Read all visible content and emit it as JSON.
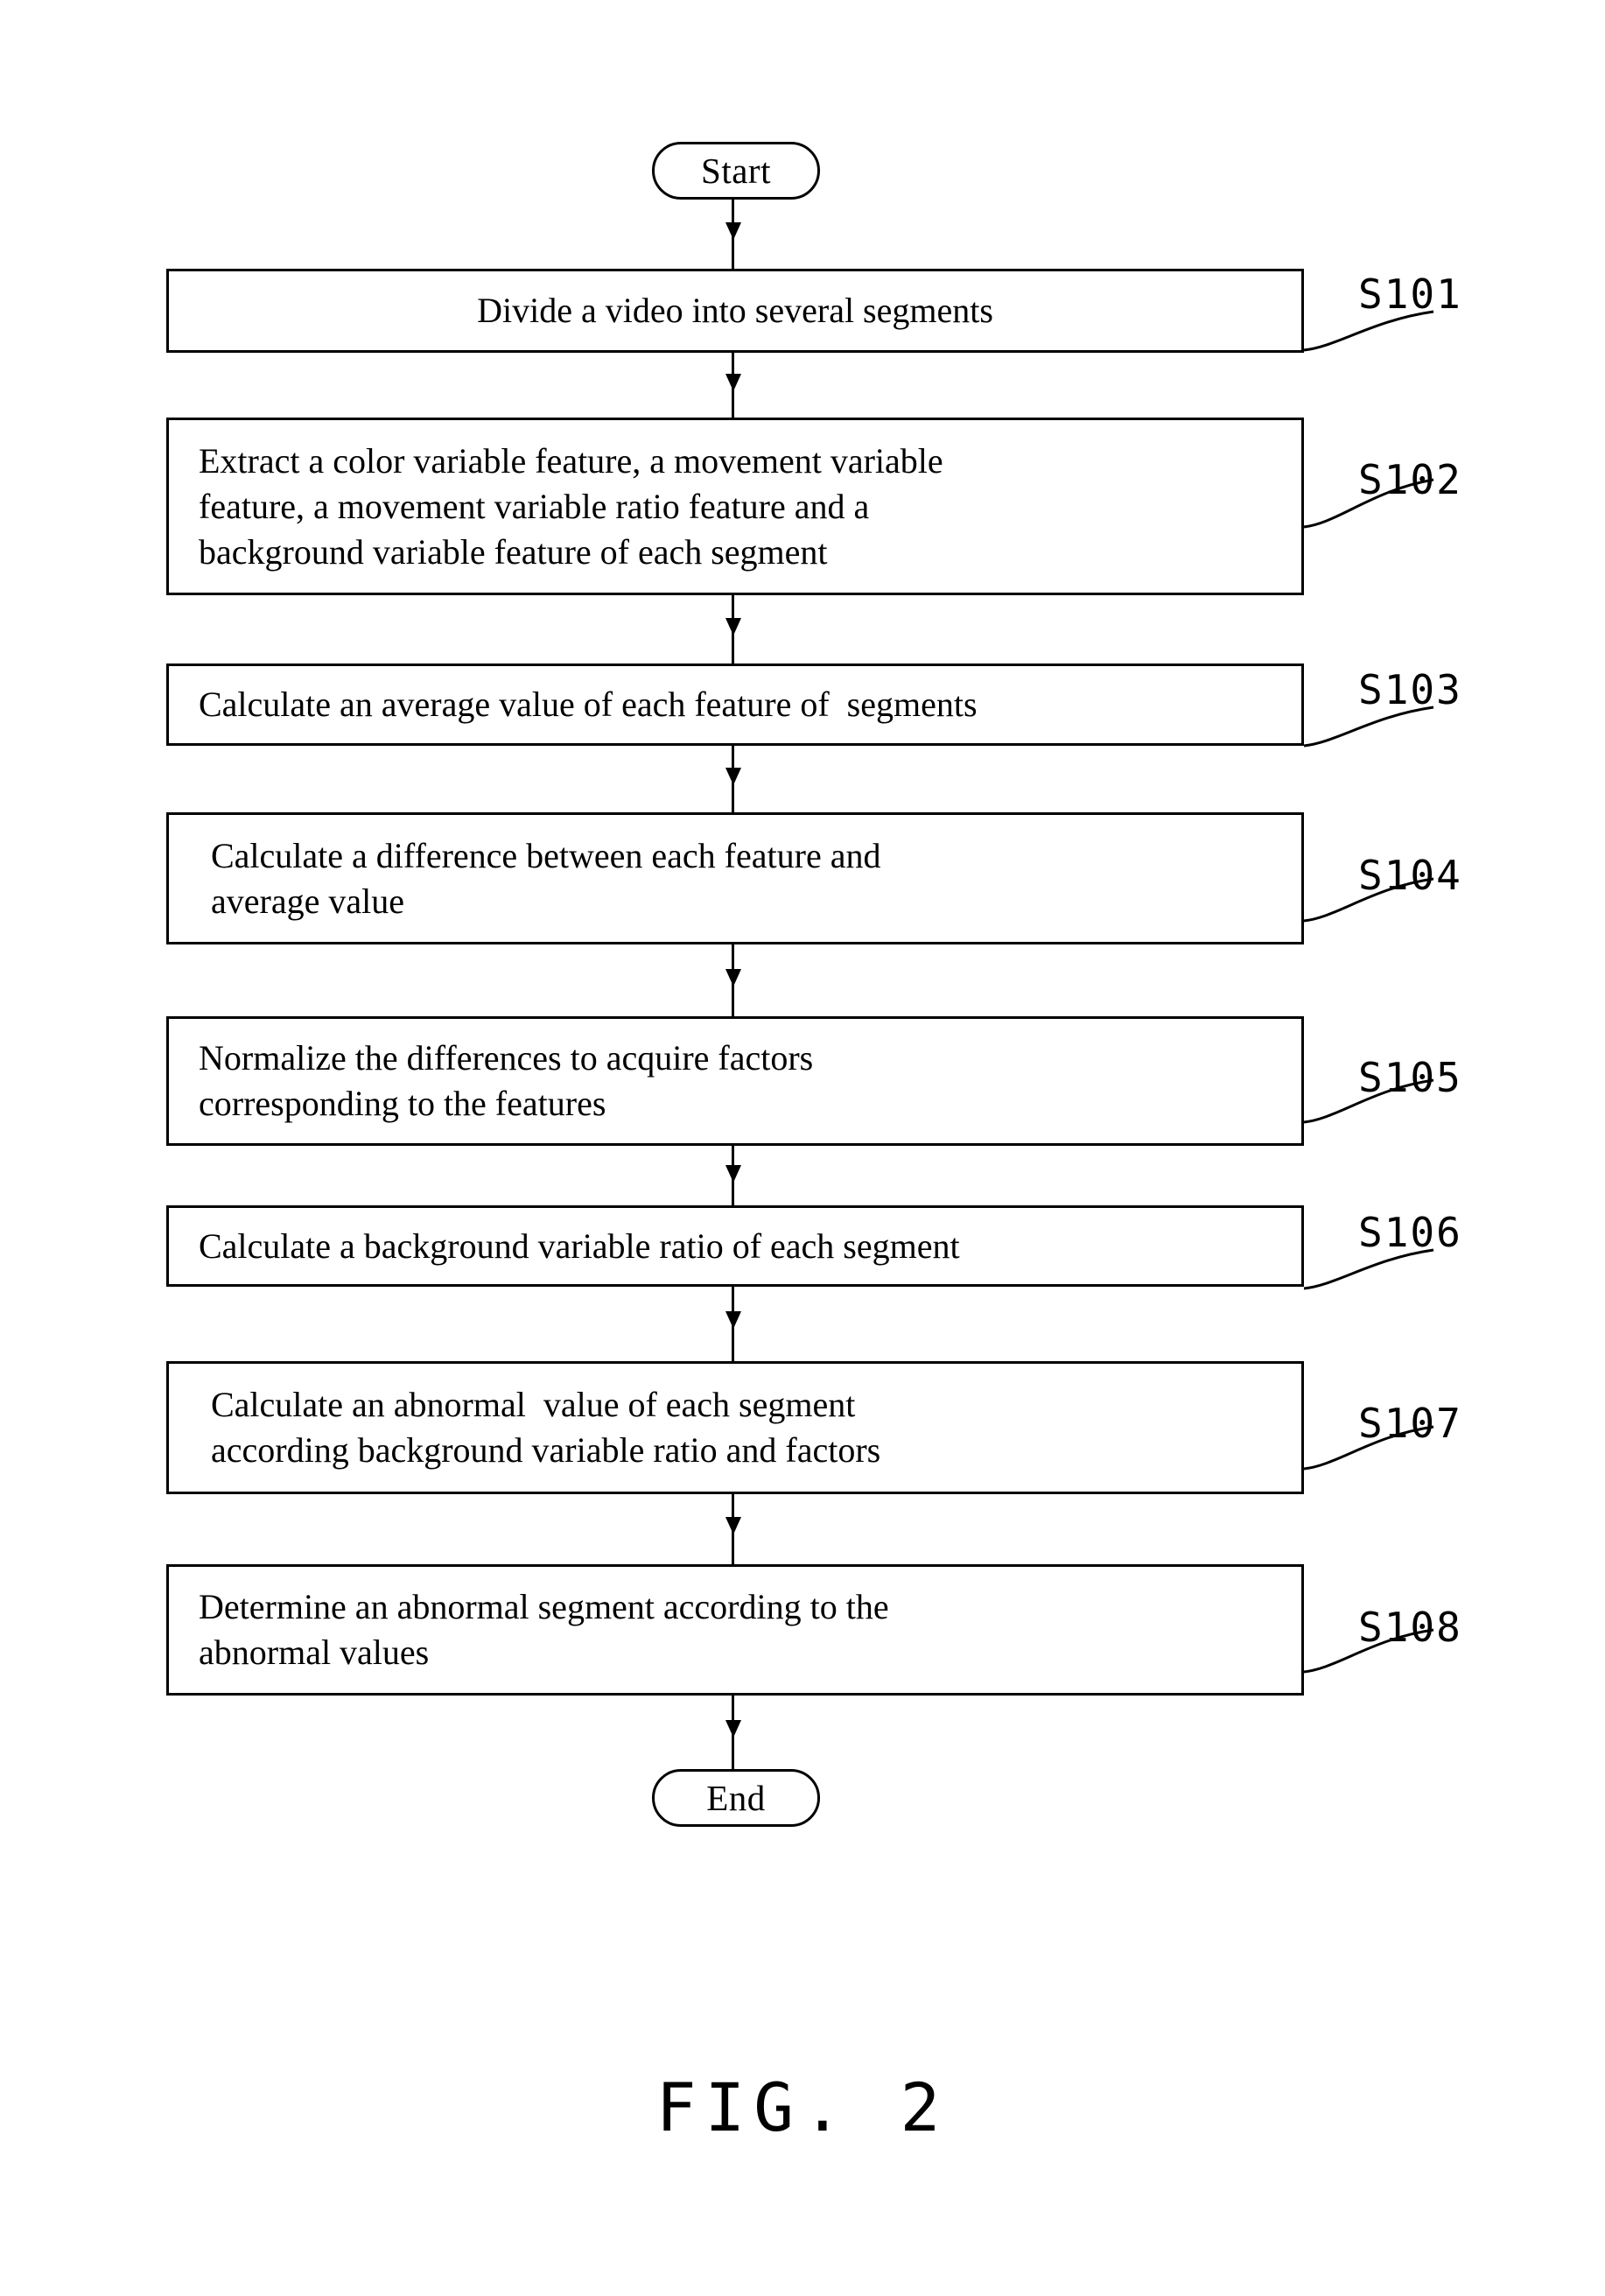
{
  "figure": {
    "caption": "FIG. 2",
    "start_label": "Start",
    "end_label": "End"
  },
  "steps": [
    {
      "ref": "S101",
      "text": "Divide a video into several segments",
      "align": "center"
    },
    {
      "ref": "S102",
      "text": "Extract a color variable feature, a movement variable\nfeature, a movement variable ratio feature and a\nbackground variable feature of each segment",
      "align": "left"
    },
    {
      "ref": "S103",
      "text": "Calculate an average value of each feature of  segments",
      "align": "left"
    },
    {
      "ref": "S104",
      "text": "Calculate a difference between each feature and\naverage value",
      "align": "left-indent"
    },
    {
      "ref": "S105",
      "text": "Normalize the differences to acquire factors\ncorresponding to the features",
      "align": "left"
    },
    {
      "ref": "S106",
      "text": "Calculate a background variable ratio of each segment",
      "align": "left"
    },
    {
      "ref": "S107",
      "text": "Calculate an abnormal  value of each segment\naccording background variable ratio and factors",
      "align": "left-indent"
    },
    {
      "ref": "S108",
      "text": "Determine an abnormal segment according to the\nabnormal values",
      "align": "left"
    }
  ],
  "colors": {
    "stroke": "#000000",
    "background": "#ffffff"
  }
}
